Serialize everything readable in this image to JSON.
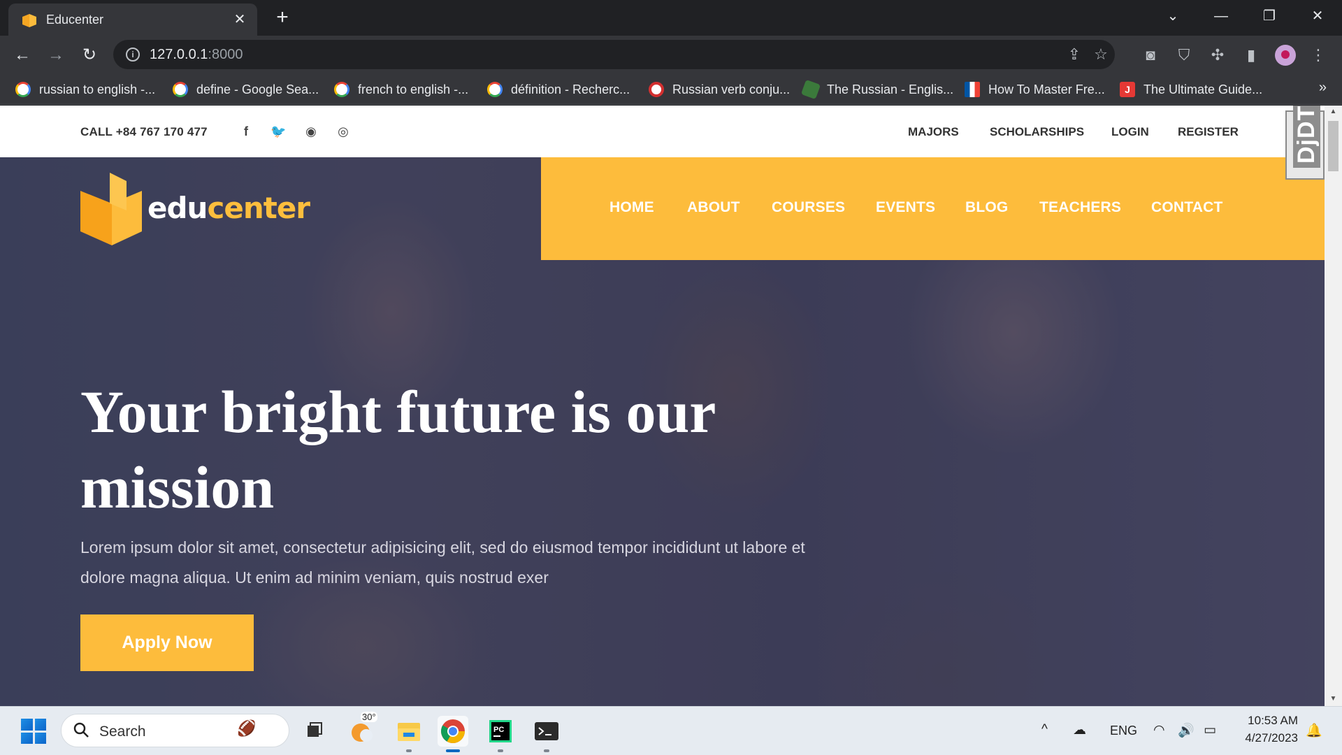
{
  "browser": {
    "tab_title": "Educenter",
    "tab_close_glyph": "✕",
    "new_tab_glyph": "+",
    "url_host": "127.0.0.1",
    "url_port": ":8000",
    "bookmarks": [
      {
        "label": "russian to english -...",
        "icon": "google-icon"
      },
      {
        "label": "define - Google Sea...",
        "icon": "google-icon"
      },
      {
        "label": "french to english -...",
        "icon": "google-icon"
      },
      {
        "label": "définition - Recherc...",
        "icon": "google-icon"
      },
      {
        "label": "Russian verb conju...",
        "icon": "reverso-icon"
      },
      {
        "label": "The Russian - Englis...",
        "icon": "russian-dictionary-icon"
      },
      {
        "label": "How To Master Fre...",
        "icon": "french-flag-icon"
      },
      {
        "label": "The Ultimate Guide...",
        "icon": "j-icon",
        "glyph": "J"
      }
    ],
    "bookmarks_more": "»"
  },
  "site": {
    "topbar": {
      "call": "CALL +84 767 170 477",
      "social": [
        {
          "name": "facebook-icon",
          "glyph": "f"
        },
        {
          "name": "twitter-icon",
          "glyph": "🐦"
        },
        {
          "name": "github-icon",
          "glyph": "◉"
        },
        {
          "name": "instagram-icon",
          "glyph": "◎"
        }
      ],
      "links": [
        "MAJORS",
        "SCHOLARSHIPS",
        "LOGIN",
        "REGISTER"
      ]
    },
    "logo": {
      "edu": "edu",
      "center": "center"
    },
    "nav": [
      "HOME",
      "ABOUT",
      "COURSES",
      "EVENTS",
      "BLOG",
      "TEACHERS",
      "CONTACT"
    ],
    "hero": {
      "title": "Your bright future is our mission",
      "subtitle": "Lorem ipsum dolor sit amet, consectetur adipisicing elit, sed do eiusmod tempor incididunt ut labore et dolore magna aliqua. Ut enim ad minim veniam, quis nostrud exer",
      "cta": "Apply Now"
    },
    "djdt_label": "DjDT"
  },
  "taskbar": {
    "search_label": "Search",
    "weather_temp": "30°",
    "language": "ENG",
    "time": "10:53 AM",
    "date": "4/27/2023"
  },
  "colors": {
    "accent": "#fdbc3c",
    "chrome_dark": "#202124",
    "chrome_mid": "#35363a",
    "hero_overlay": "#2a2c46"
  }
}
